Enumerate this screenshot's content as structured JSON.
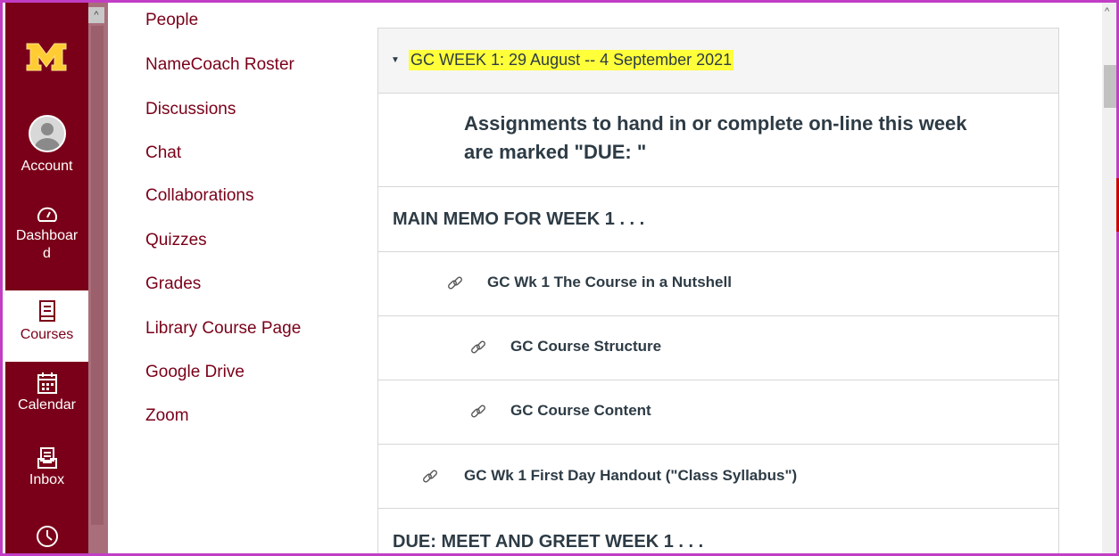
{
  "global_nav": {
    "items": [
      {
        "label": "Account",
        "icon": "avatar"
      },
      {
        "label": "Dashboar d",
        "icon": "dashboard-icon"
      },
      {
        "label": "Courses",
        "icon": "courses-icon",
        "active": true
      },
      {
        "label": "Calendar",
        "icon": "calendar-icon"
      },
      {
        "label": "Inbox",
        "icon": "inbox-icon"
      },
      {
        "label": "",
        "icon": "history-icon"
      }
    ],
    "colors": {
      "background": "#7a0019",
      "logo": "#ffcc33"
    }
  },
  "course_nav": {
    "items": [
      "People",
      "NameCoach Roster",
      "Discussions",
      "Chat",
      "Collaborations",
      "Quizzes",
      "Grades",
      "Library Course Page",
      "Google Drive",
      "Zoom"
    ]
  },
  "module": {
    "title": "GC WEEK 1: 29 August -- 4 September 2021",
    "highlight_color": "#ffff3a",
    "items": [
      {
        "type": "subheader",
        "text_line1": "Assignments to hand in or complete on-line this week",
        "text_line2": "are marked \"DUE: \""
      },
      {
        "type": "header",
        "text": "MAIN MEMO FOR WEEK 1 . . ."
      },
      {
        "type": "link",
        "text": "GC Wk 1 The Course in a Nutshell",
        "icon": "link-icon"
      },
      {
        "type": "link",
        "text": "GC Course Structure",
        "icon": "link-icon"
      },
      {
        "type": "link",
        "text": "GC Course Content",
        "icon": "link-icon"
      },
      {
        "type": "link",
        "text": "GC Wk 1 First Day Handout (\"Class Syllabus\")",
        "icon": "link-icon"
      },
      {
        "type": "header",
        "text": "DUE: MEET AND GREET WEEK 1 . . ."
      }
    ]
  }
}
